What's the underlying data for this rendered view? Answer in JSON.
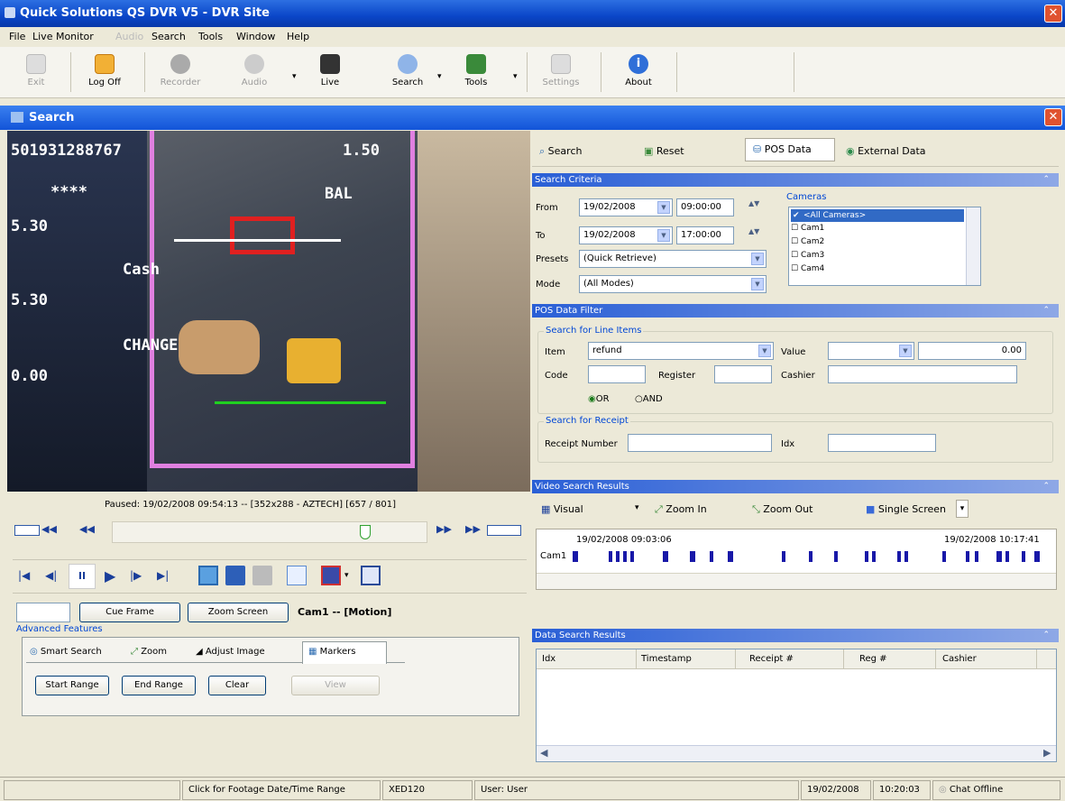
{
  "app": {
    "title": "Quick Solutions QS DVR V5 - DVR Site"
  },
  "menu": [
    "File",
    "Live Monitor",
    "Audio",
    "Search",
    "Tools",
    "Window",
    "Help"
  ],
  "toolbar": {
    "exit": "Exit",
    "logoff": "Log Off",
    "recorder": "Recorder",
    "audio": "Audio",
    "live": "Live",
    "search": "Search",
    "tools": "Tools",
    "settings": "Settings",
    "about": "About"
  },
  "search_window": {
    "title": "Search"
  },
  "video": {
    "overlay": {
      "code": "501931288767",
      "price": "1.50",
      "stars": "****",
      "bal": "BAL",
      "amount1": "5.30",
      "cash": "Cash",
      "amount2": "5.30",
      "change": "CHANGE",
      "amount3": "0.00"
    },
    "status": "Paused: 19/02/2008 09:54:13 -- [352x288 - AZTECH] [657 / 801]",
    "cue_frame": "Cue Frame",
    "zoom_screen": "Zoom Screen",
    "camera_label": "Cam1 -- [Motion]"
  },
  "advanced": {
    "title": "Advanced Features",
    "tabs": [
      "Smart Search",
      "Zoom",
      "Adjust Image",
      "Markers"
    ],
    "start_range": "Start Range",
    "end_range": "End Range",
    "clear": "Clear",
    "view": "View"
  },
  "right_toolbar": {
    "search": "Search",
    "reset": "Reset",
    "pos_data": "POS Data",
    "external": "External Data"
  },
  "criteria": {
    "title": "Search Criteria",
    "from_label": "From",
    "from_date": "19/02/2008",
    "from_time": "09:00:00",
    "to_label": "To",
    "to_date": "19/02/2008",
    "to_time": "17:00:00",
    "presets_label": "Presets",
    "presets_value": "(Quick Retrieve)",
    "mode_label": "Mode",
    "mode_value": "(All Modes)",
    "cameras_label": "Cameras",
    "cameras": [
      "<All Cameras>",
      "Cam1",
      "Cam2",
      "Cam3",
      "Cam4"
    ]
  },
  "pos_filter": {
    "title": "POS Data Filter",
    "line_items_title": "Search for Line Items",
    "item_label": "Item",
    "item_value": "refund",
    "value_label": "Value",
    "value_amount": "0.00",
    "code_label": "Code",
    "register_label": "Register",
    "cashier_label": "Cashier",
    "or_label": "OR",
    "and_label": "AND",
    "receipt_title": "Search for Receipt",
    "receipt_label": "Receipt Number",
    "idx_label": "Idx"
  },
  "video_results": {
    "title": "Video Search Results",
    "visual": "Visual",
    "zoom_in": "Zoom In",
    "zoom_out": "Zoom Out",
    "single_screen": "Single Screen",
    "start_time": "19/02/2008 09:03:06",
    "end_time": "19/02/2008 10:17:41",
    "camera": "Cam1"
  },
  "data_results": {
    "title": "Data Search Results",
    "columns": [
      "Idx",
      "Timestamp",
      "Receipt #",
      "Reg #",
      "Cashier"
    ]
  },
  "status": {
    "hint": "Click for Footage Date/Time Range",
    "host": "XED120",
    "user": "User: User",
    "date": "19/02/2008",
    "time": "10:20:03",
    "chat": "Chat Offline"
  }
}
